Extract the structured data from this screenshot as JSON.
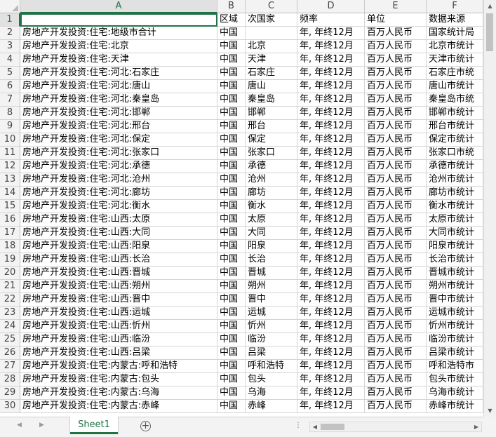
{
  "column_headers": [
    "A",
    "B",
    "C",
    "D",
    "E",
    "F"
  ],
  "header_row": [
    "",
    "区域",
    "次国家",
    "频率",
    "单位",
    "数据来源"
  ],
  "rows": [
    {
      "num": "2",
      "a": "房地产开发投资:住宅:地级市合计",
      "b": "中国",
      "c": "",
      "d": "年, 年终12月",
      "e": "百万人民币",
      "f": "国家统计局"
    },
    {
      "num": "3",
      "a": "房地产开发投资:住宅:北京",
      "b": "中国",
      "c": "北京",
      "d": "年, 年终12月",
      "e": "百万人民币",
      "f": "北京市统计"
    },
    {
      "num": "4",
      "a": "房地产开发投资:住宅:天津",
      "b": "中国",
      "c": "天津",
      "d": "年, 年终12月",
      "e": "百万人民币",
      "f": "天津市统计"
    },
    {
      "num": "5",
      "a": "房地产开发投资:住宅:河北:石家庄",
      "b": "中国",
      "c": "石家庄",
      "d": "年, 年终12月",
      "e": "百万人民币",
      "f": "石家庄市统"
    },
    {
      "num": "6",
      "a": "房地产开发投资:住宅:河北:唐山",
      "b": "中国",
      "c": "唐山",
      "d": "年, 年终12月",
      "e": "百万人民币",
      "f": "唐山市统计"
    },
    {
      "num": "7",
      "a": "房地产开发投资:住宅:河北:秦皇岛",
      "b": "中国",
      "c": "秦皇岛",
      "d": "年, 年终12月",
      "e": "百万人民币",
      "f": "秦皇岛市统"
    },
    {
      "num": "8",
      "a": "房地产开发投资:住宅:河北:邯郸",
      "b": "中国",
      "c": "邯郸",
      "d": "年, 年终12月",
      "e": "百万人民币",
      "f": "邯郸市统计"
    },
    {
      "num": "9",
      "a": "房地产开发投资:住宅:河北:邢台",
      "b": "中国",
      "c": "邢台",
      "d": "年, 年终12月",
      "e": "百万人民币",
      "f": "邢台市统计"
    },
    {
      "num": "10",
      "a": "房地产开发投资:住宅:河北:保定",
      "b": "中国",
      "c": "保定",
      "d": "年, 年终12月",
      "e": "百万人民币",
      "f": "保定市统计"
    },
    {
      "num": "11",
      "a": "房地产开发投资:住宅:河北:张家口",
      "b": "中国",
      "c": "张家口",
      "d": "年, 年终12月",
      "e": "百万人民币",
      "f": "张家口市统"
    },
    {
      "num": "12",
      "a": "房地产开发投资:住宅:河北:承德",
      "b": "中国",
      "c": "承德",
      "d": "年, 年终12月",
      "e": "百万人民币",
      "f": "承德市统计"
    },
    {
      "num": "13",
      "a": "房地产开发投资:住宅:河北:沧州",
      "b": "中国",
      "c": "沧州",
      "d": "年, 年终12月",
      "e": "百万人民币",
      "f": "沧州市统计"
    },
    {
      "num": "14",
      "a": "房地产开发投资:住宅:河北:廊坊",
      "b": "中国",
      "c": "廊坊",
      "d": "年, 年终12月",
      "e": "百万人民币",
      "f": "廊坊市统计"
    },
    {
      "num": "15",
      "a": "房地产开发投资:住宅:河北:衡水",
      "b": "中国",
      "c": "衡水",
      "d": "年, 年终12月",
      "e": "百万人民币",
      "f": "衡水市统计"
    },
    {
      "num": "16",
      "a": "房地产开发投资:住宅:山西:太原",
      "b": "中国",
      "c": "太原",
      "d": "年, 年终12月",
      "e": "百万人民币",
      "f": "太原市统计"
    },
    {
      "num": "17",
      "a": "房地产开发投资:住宅:山西:大同",
      "b": "中国",
      "c": "大同",
      "d": "年, 年终12月",
      "e": "百万人民币",
      "f": "大同市统计"
    },
    {
      "num": "18",
      "a": "房地产开发投资:住宅:山西:阳泉",
      "b": "中国",
      "c": "阳泉",
      "d": "年, 年终12月",
      "e": "百万人民币",
      "f": "阳泉市统计"
    },
    {
      "num": "19",
      "a": "房地产开发投资:住宅:山西:长治",
      "b": "中国",
      "c": "长治",
      "d": "年, 年终12月",
      "e": "百万人民币",
      "f": "长治市统计"
    },
    {
      "num": "20",
      "a": "房地产开发投资:住宅:山西:晋城",
      "b": "中国",
      "c": "晋城",
      "d": "年, 年终12月",
      "e": "百万人民币",
      "f": "晋城市统计"
    },
    {
      "num": "21",
      "a": "房地产开发投资:住宅:山西:朔州",
      "b": "中国",
      "c": "朔州",
      "d": "年, 年终12月",
      "e": "百万人民币",
      "f": "朔州市统计"
    },
    {
      "num": "22",
      "a": "房地产开发投资:住宅:山西:晋中",
      "b": "中国",
      "c": "晋中",
      "d": "年, 年终12月",
      "e": "百万人民币",
      "f": "晋中市统计"
    },
    {
      "num": "23",
      "a": "房地产开发投资:住宅:山西:运城",
      "b": "中国",
      "c": "运城",
      "d": "年, 年终12月",
      "e": "百万人民币",
      "f": "运城市统计"
    },
    {
      "num": "24",
      "a": "房地产开发投资:住宅:山西:忻州",
      "b": "中国",
      "c": "忻州",
      "d": "年, 年终12月",
      "e": "百万人民币",
      "f": "忻州市统计"
    },
    {
      "num": "25",
      "a": "房地产开发投资:住宅:山西:临汾",
      "b": "中国",
      "c": "临汾",
      "d": "年, 年终12月",
      "e": "百万人民币",
      "f": "临汾市统计"
    },
    {
      "num": "26",
      "a": "房地产开发投资:住宅:山西:吕梁",
      "b": "中国",
      "c": "吕梁",
      "d": "年, 年终12月",
      "e": "百万人民币",
      "f": "吕梁市统计"
    },
    {
      "num": "27",
      "a": "房地产开发投资:住宅:内蒙古:呼和浩特",
      "b": "中国",
      "c": "呼和浩特",
      "d": "年, 年终12月",
      "e": "百万人民币",
      "f": "呼和浩特市"
    },
    {
      "num": "28",
      "a": "房地产开发投资:住宅:内蒙古:包头",
      "b": "中国",
      "c": "包头",
      "d": "年, 年终12月",
      "e": "百万人民币",
      "f": "包头市统计"
    },
    {
      "num": "29",
      "a": "房地产开发投资:住宅:内蒙古:乌海",
      "b": "中国",
      "c": "乌海",
      "d": "年, 年终12月",
      "e": "百万人民币",
      "f": "乌海市统计"
    },
    {
      "num": "30",
      "a": "房地产开发投资:住宅:内蒙古:赤峰",
      "b": "中国",
      "c": "赤峰",
      "d": "年, 年终12月",
      "e": "百万人民币",
      "f": "赤峰市统计"
    }
  ],
  "sheet_tab": "Sheet1",
  "add_sheet_symbol": "+",
  "nav_prev": "◀",
  "nav_next": "▶",
  "more_indicator": "⋮",
  "accent_color": "#217346"
}
